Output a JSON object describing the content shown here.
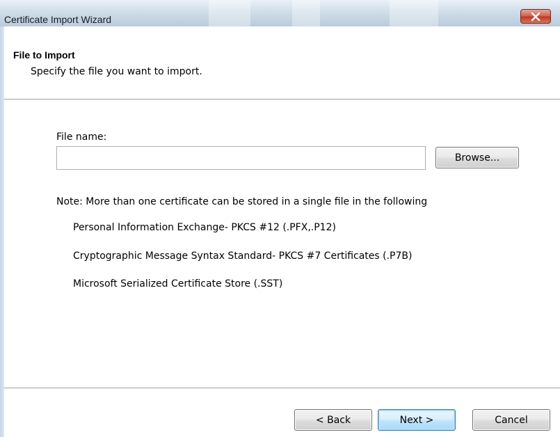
{
  "window": {
    "title": "Certificate Import Wizard",
    "close_icon": "close-icon"
  },
  "header": {
    "title": "File to Import",
    "subtitle": "Specify the file you want to import."
  },
  "file": {
    "label": "File name:",
    "value": "",
    "placeholder": "",
    "browse_label": "Browse..."
  },
  "note": {
    "text": "Note:  More than one certificate can be stored in a single file in the following",
    "formats": [
      "Personal Information Exchange- PKCS #12 (.PFX,.P12)",
      "Cryptographic Message Syntax Standard- PKCS #7 Certificates (.P7B)",
      "Microsoft Serialized Certificate Store (.SST)"
    ]
  },
  "footer": {
    "back_label": "< Back",
    "next_label": "Next >",
    "cancel_label": "Cancel"
  },
  "colors": {
    "close_button": "#c1381f",
    "default_button_border": "#3c7fb1"
  }
}
